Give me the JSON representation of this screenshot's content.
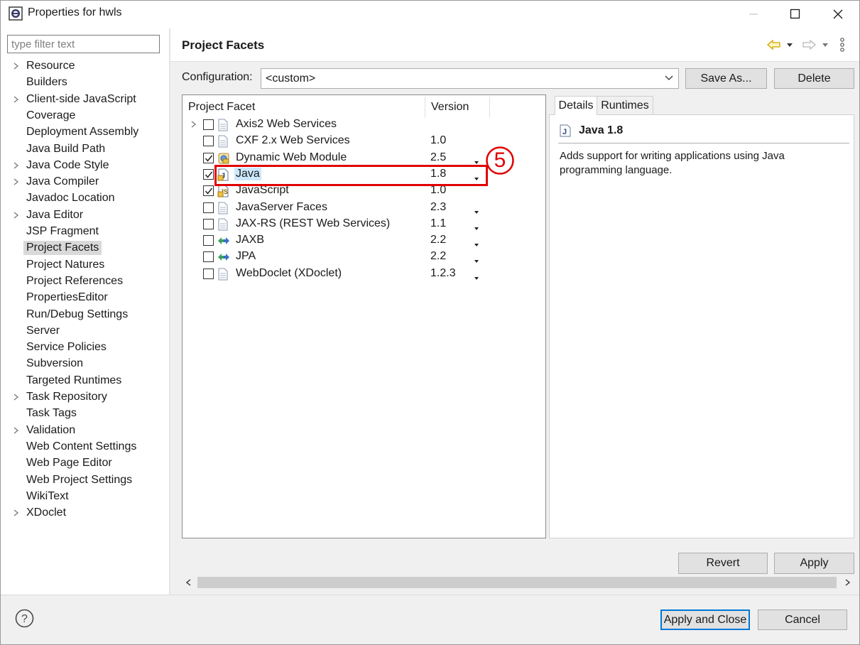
{
  "window": {
    "title": "Properties for hwls",
    "controls": [
      "minimize",
      "maximize",
      "close"
    ]
  },
  "sidebar": {
    "filter_placeholder": "type filter text",
    "items": [
      {
        "label": "Resource",
        "expandable": true
      },
      {
        "label": "Builders",
        "expandable": false
      },
      {
        "label": "Client-side JavaScript",
        "expandable": true
      },
      {
        "label": "Coverage",
        "expandable": false
      },
      {
        "label": "Deployment Assembly",
        "expandable": false
      },
      {
        "label": "Java Build Path",
        "expandable": false
      },
      {
        "label": "Java Code Style",
        "expandable": true
      },
      {
        "label": "Java Compiler",
        "expandable": true
      },
      {
        "label": "Javadoc Location",
        "expandable": false
      },
      {
        "label": "Java Editor",
        "expandable": true
      },
      {
        "label": "JSP Fragment",
        "expandable": false
      },
      {
        "label": "Project Facets",
        "expandable": false,
        "selected": true
      },
      {
        "label": "Project Natures",
        "expandable": false
      },
      {
        "label": "Project References",
        "expandable": false
      },
      {
        "label": "PropertiesEditor",
        "expandable": false
      },
      {
        "label": "Run/Debug Settings",
        "expandable": false
      },
      {
        "label": "Server",
        "expandable": false
      },
      {
        "label": "Service Policies",
        "expandable": false
      },
      {
        "label": "Subversion",
        "expandable": false
      },
      {
        "label": "Targeted Runtimes",
        "expandable": false
      },
      {
        "label": "Task Repository",
        "expandable": true
      },
      {
        "label": "Task Tags",
        "expandable": false
      },
      {
        "label": "Validation",
        "expandable": true
      },
      {
        "label": "Web Content Settings",
        "expandable": false
      },
      {
        "label": "Web Page Editor",
        "expandable": false
      },
      {
        "label": "Web Project Settings",
        "expandable": false
      },
      {
        "label": "WikiText",
        "expandable": false
      },
      {
        "label": "XDoclet",
        "expandable": true
      }
    ]
  },
  "page": {
    "title": "Project Facets",
    "nav_icons": [
      "back-arrow-icon",
      "forward-arrow-icon",
      "view-menu-icon"
    ]
  },
  "configuration": {
    "label": "Configuration:",
    "value": "<custom>",
    "save_as_label": "Save As...",
    "delete_label": "Delete"
  },
  "facets": {
    "col_facet": "Project Facet",
    "col_version": "Version",
    "rows": [
      {
        "name": "Axis2 Web Services",
        "version": "",
        "checked": false,
        "expandable": true,
        "icon": "doc-icon",
        "dropdown": false
      },
      {
        "name": "CXF 2.x Web Services",
        "version": "1.0",
        "checked": false,
        "expandable": false,
        "icon": "doc-icon",
        "dropdown": false
      },
      {
        "name": "Dynamic Web Module",
        "version": "2.5",
        "checked": true,
        "expandable": false,
        "icon": "web-module-icon",
        "dropdown": true
      },
      {
        "name": "Java",
        "version": "1.8",
        "checked": true,
        "expandable": false,
        "icon": "java-facet-icon",
        "dropdown": true,
        "highlighted": true
      },
      {
        "name": "JavaScript",
        "version": "1.0",
        "checked": true,
        "expandable": false,
        "icon": "js-facet-icon",
        "dropdown": false
      },
      {
        "name": "JavaServer Faces",
        "version": "2.3",
        "checked": false,
        "expandable": false,
        "icon": "doc-icon",
        "dropdown": true
      },
      {
        "name": "JAX-RS (REST Web Services)",
        "version": "1.1",
        "checked": false,
        "expandable": false,
        "icon": "doc-icon",
        "dropdown": true
      },
      {
        "name": "JAXB",
        "version": "2.2",
        "checked": false,
        "expandable": false,
        "icon": "bidir-arrow-icon",
        "dropdown": true
      },
      {
        "name": "JPA",
        "version": "2.2",
        "checked": false,
        "expandable": false,
        "icon": "bidir-arrow-icon",
        "dropdown": true
      },
      {
        "name": "WebDoclet (XDoclet)",
        "version": "1.2.3",
        "checked": false,
        "expandable": false,
        "icon": "doc-icon",
        "dropdown": true
      }
    ]
  },
  "annotation": {
    "number": "5",
    "color": "#e00000"
  },
  "details": {
    "tabs": [
      "Details",
      "Runtimes"
    ],
    "active_tab": "Details",
    "title": "Java 1.8",
    "description": "Adds support for writing applications using Java programming language."
  },
  "actions": {
    "revert_label": "Revert",
    "apply_label": "Apply",
    "apply_close_label": "Apply and Close",
    "cancel_label": "Cancel"
  },
  "colors": {
    "accent": "#0078d7",
    "selection": "#cce8ff",
    "annotation": "#e00000"
  }
}
